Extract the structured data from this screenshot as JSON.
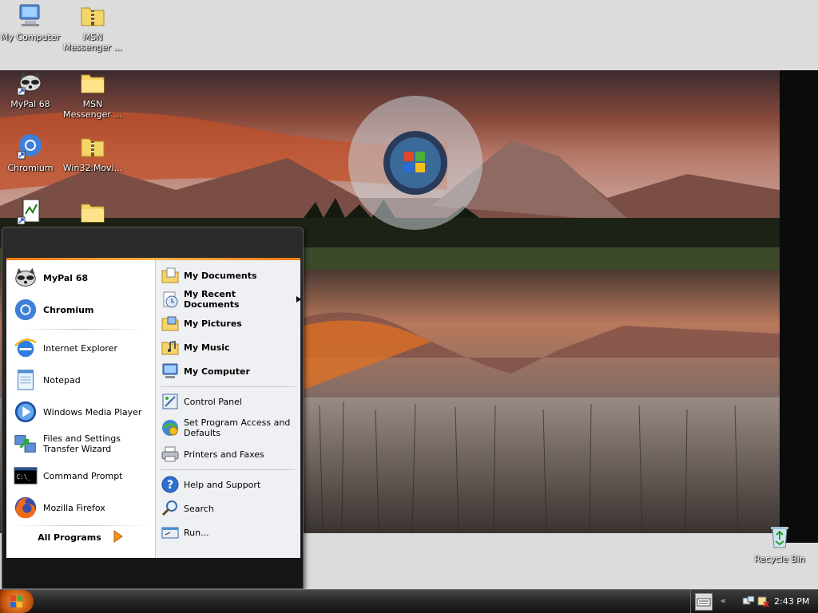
{
  "desktop": {
    "icons": [
      {
        "label": "My Computer"
      },
      {
        "label": "MSN Messenger ..."
      },
      {
        "label": "MyPal 68"
      },
      {
        "label": "MSN Messenger ..."
      },
      {
        "label": "Chromium"
      },
      {
        "label": "Win32.Movi..."
      },
      {
        "label": ""
      },
      {
        "label": ""
      },
      {
        "label": "Recycle Bin"
      }
    ]
  },
  "start_menu": {
    "pinned": [
      {
        "label": "MyPal 68"
      },
      {
        "label": "Chromium"
      }
    ],
    "recent": [
      {
        "label": "Internet Explorer"
      },
      {
        "label": "Notepad"
      },
      {
        "label": "Windows Media Player"
      },
      {
        "label": "Files and Settings Transfer Wizard"
      },
      {
        "label": "Command Prompt"
      },
      {
        "label": "Mozilla Firefox"
      }
    ],
    "all_programs_label": "All Programs",
    "places": [
      {
        "label": "My Documents"
      },
      {
        "label": "My Recent Documents"
      },
      {
        "label": "My Pictures"
      },
      {
        "label": "My Music"
      },
      {
        "label": "My Computer"
      }
    ],
    "system": [
      {
        "label": "Control Panel"
      },
      {
        "label": "Set Program Access and Defaults"
      },
      {
        "label": "Printers and Faxes"
      }
    ],
    "help": [
      {
        "label": "Help and Support"
      },
      {
        "label": "Search"
      },
      {
        "label": "Run..."
      }
    ]
  },
  "taskbar": {
    "tray_chevron": "«",
    "clock": "2:43 PM"
  }
}
